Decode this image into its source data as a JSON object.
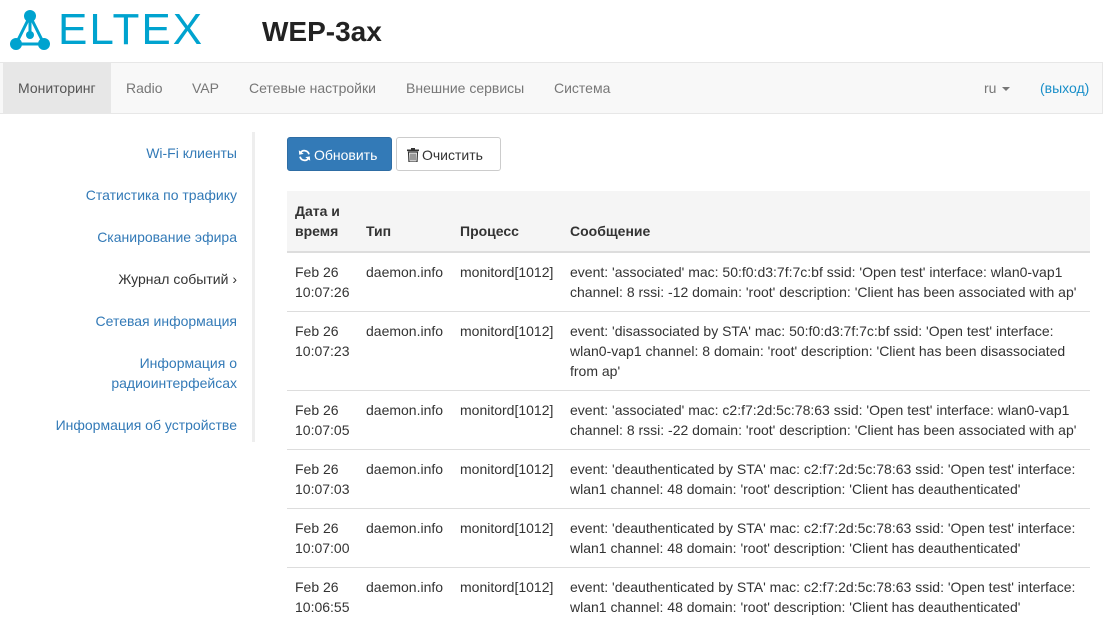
{
  "brand": {
    "logo_text": "ELTEX",
    "product": "WEP-3ax"
  },
  "nav": {
    "items": [
      "Мониторинг",
      "Radio",
      "VAP",
      "Сетевые настройки",
      "Внешние сервисы",
      "Система"
    ],
    "active": "Мониторинг",
    "language": "ru",
    "logout": "(выход)"
  },
  "sidebar": {
    "items": [
      {
        "label": "Wi-Fi клиенты"
      },
      {
        "label": "Статистика по трафику"
      },
      {
        "label": "Сканирование эфира"
      },
      {
        "label": "Журнал событий"
      },
      {
        "label": "Сетевая информация"
      },
      {
        "label": "Информация о радиоинтерфейсах"
      },
      {
        "label": "Информация об устройстве"
      }
    ],
    "active": "Журнал событий",
    "active_marker": "›"
  },
  "toolbar": {
    "refresh_label": "Обновить",
    "clear_label": "Очистить"
  },
  "table": {
    "columns": [
      "Дата и время",
      "Тип",
      "Процесс",
      "Сообщение"
    ],
    "rows": [
      {
        "date": "Feb 26",
        "time": "10:07:26",
        "type": "daemon.info",
        "process": "monitord[1012]",
        "message": "event: 'associated' mac: 50:f0:d3:7f:7c:bf ssid: 'Open test' interface: wlan0-vap1 channel: 8 rssi: -12 domain: 'root' description: 'Client has been associated with ap'"
      },
      {
        "date": "Feb 26",
        "time": "10:07:23",
        "type": "daemon.info",
        "process": "monitord[1012]",
        "message": "event: 'disassociated by STA' mac: 50:f0:d3:7f:7c:bf ssid: 'Open test' interface: wlan0-vap1 channel: 8 domain: 'root' description: 'Client has been disassociated from ap'"
      },
      {
        "date": "Feb 26",
        "time": "10:07:05",
        "type": "daemon.info",
        "process": "monitord[1012]",
        "message": "event: 'associated' mac: c2:f7:2d:5c:78:63 ssid: 'Open test' interface: wlan0-vap1 channel: 8 rssi: -22 domain: 'root' description: 'Client has been associated with ap'"
      },
      {
        "date": "Feb 26",
        "time": "10:07:03",
        "type": "daemon.info",
        "process": "monitord[1012]",
        "message": "event: 'deauthenticated by STA' mac: c2:f7:2d:5c:78:63 ssid: 'Open test' interface: wlan1 channel: 48 domain: 'root' description: 'Client has deauthenticated'"
      },
      {
        "date": "Feb 26",
        "time": "10:07:00",
        "type": "daemon.info",
        "process": "monitord[1012]",
        "message": "event: 'deauthenticated by STA' mac: c2:f7:2d:5c:78:63 ssid: 'Open test' interface: wlan1 channel: 48 domain: 'root' description: 'Client has deauthenticated'"
      },
      {
        "date": "Feb 26",
        "time": "10:06:55",
        "type": "daemon.info",
        "process": "monitord[1012]",
        "message": "event: 'deauthenticated by STA' mac: c2:f7:2d:5c:78:63 ssid: 'Open test' interface: wlan1 channel: 48 domain: 'root' description: 'Client has deauthenticated'"
      }
    ]
  },
  "colors": {
    "brand": "#00a3cf",
    "link": "#337ab7",
    "primary": "#337ab7"
  },
  "icons": {
    "logo": "eltex-network-icon",
    "refresh": "refresh-icon",
    "clear": "trash-icon",
    "dropdown": "caret-down-icon"
  }
}
